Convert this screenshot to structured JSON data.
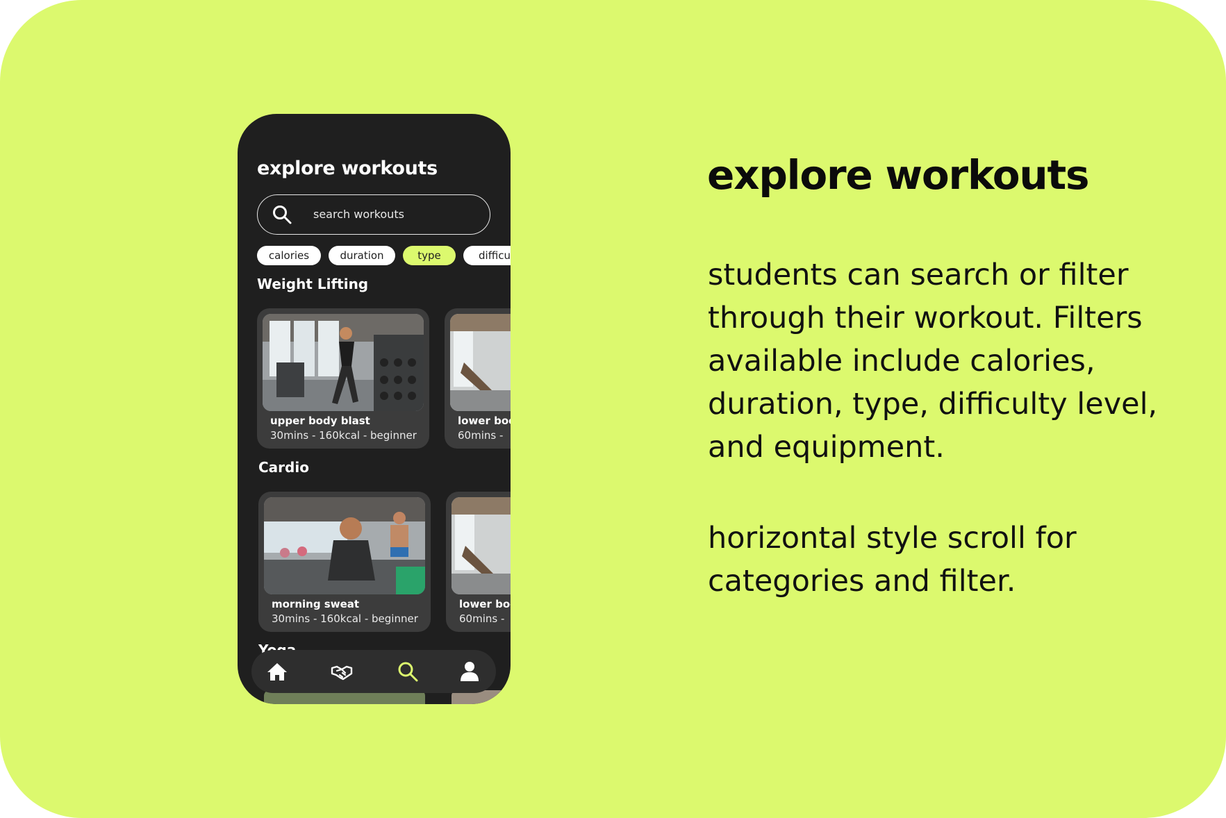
{
  "slide": {
    "title": "explore workouts",
    "paragraphs": [
      "students can search or filter through their workout. Filters available include calories, duration, type, difficulty level, and equipment.",
      "horizontal style scroll for categories and filter."
    ]
  },
  "app": {
    "title": "explore workouts",
    "search": {
      "placeholder": "search workouts"
    },
    "filters": [
      {
        "label": "calories",
        "active": false
      },
      {
        "label": "duration",
        "active": false
      },
      {
        "label": "type",
        "active": true
      },
      {
        "label": "difficu",
        "active": false
      }
    ],
    "sections": [
      {
        "title": "Weight Lifting",
        "cards": [
          {
            "name": "upper body blast",
            "meta": "30mins - 160kcal - beginner"
          },
          {
            "name": "lower boc",
            "meta": "60mins -"
          }
        ]
      },
      {
        "title": "Cardio",
        "cards": [
          {
            "name": "morning sweat",
            "meta": "30mins - 160kcal - beginner"
          },
          {
            "name": "lower boc",
            "meta": "60mins -"
          }
        ]
      },
      {
        "title": "Yoga"
      }
    ],
    "nav": [
      {
        "icon": "home-icon",
        "active": false
      },
      {
        "icon": "handshake-icon",
        "active": false
      },
      {
        "icon": "search-icon",
        "active": true
      },
      {
        "icon": "profile-icon",
        "active": false
      }
    ]
  },
  "colors": {
    "accent": "#dcf96e",
    "phone_bg": "#1f1f1f",
    "card_bg": "#3c3c3c",
    "nav_bg": "#2e2e2e"
  }
}
